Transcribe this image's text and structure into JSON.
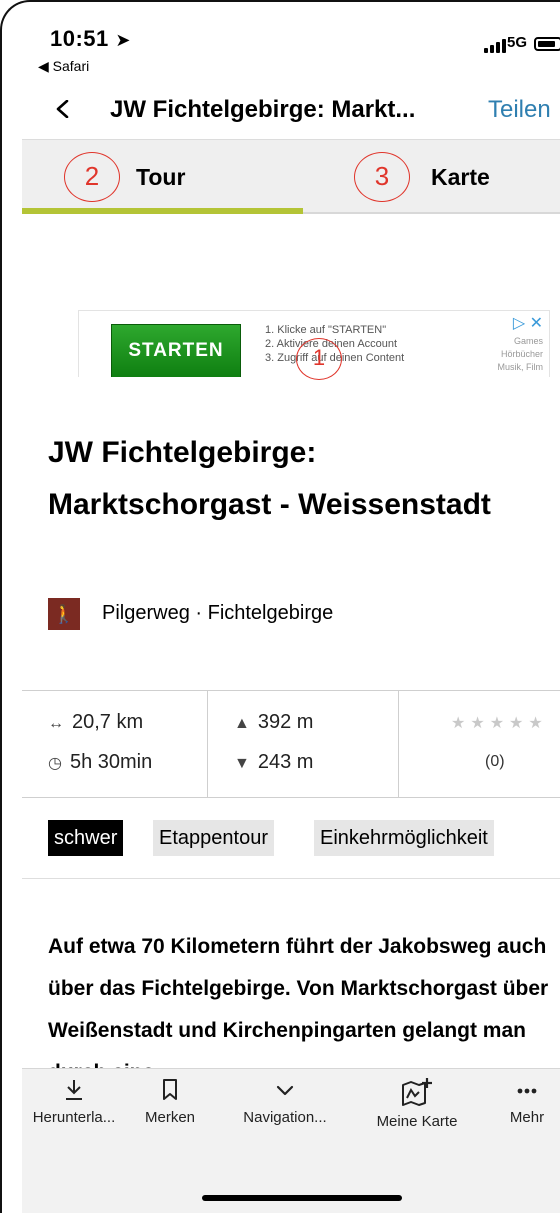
{
  "status_bar": {
    "time": "10:51",
    "back_app": "◀ Safari",
    "network": "5G"
  },
  "header": {
    "title": "JW Fichtelgebirge: Markt...",
    "share_label": "Teilen"
  },
  "tabs": [
    {
      "label": "Tour",
      "active": true,
      "annotation": "2"
    },
    {
      "label": "Karte",
      "active": false,
      "annotation": "3"
    }
  ],
  "annotation_ad": "1",
  "ad": {
    "button": "STARTEN",
    "lines": [
      "1. Klicke auf \"STARTEN\"",
      "2. Aktiviere deinen Account",
      "3. Zugriff auf deinen Content"
    ],
    "side": [
      "Games",
      "Hörbücher",
      "Musik, Film"
    ]
  },
  "tour": {
    "title": "JW Fichtelgebirge: Marktschorgast - Weissenstadt",
    "category": "Pilgerweg · Fichtelgebirge",
    "distance": "20,7 km",
    "duration": "5h 30min",
    "ascent": "392 m",
    "descent": "243 m",
    "rating_stars": 0,
    "rating_count": "(0)",
    "tags": [
      "schwer",
      "Etappentour",
      "Einkehrmöglichkeit"
    ],
    "description": "Auf etwa 70 Kilometern führt der Jakobsweg auch über das Fichtelgebirge. Von Marktschorgast über Weißenstadt und Kirchenpingarten gelangt man durch eine"
  },
  "toolbar": [
    {
      "label": "Herunterla...",
      "icon": "download-icon"
    },
    {
      "label": "Merken",
      "icon": "bookmark-icon"
    },
    {
      "label": "Navigation...",
      "icon": "chevron-down-icon"
    },
    {
      "label": "Meine Karte",
      "icon": "map-add-icon"
    },
    {
      "label": "Mehr",
      "icon": "more-icon"
    }
  ],
  "colors": {
    "accent": "#b4c436",
    "link": "#2f7fb0",
    "annotation": "#e0352b",
    "category_icon_bg": "#7b2a22"
  }
}
